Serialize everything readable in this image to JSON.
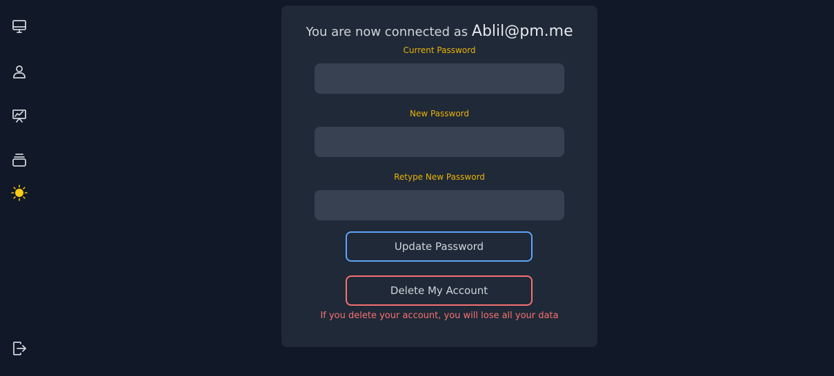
{
  "sidebar": {
    "icons": [
      "monitor-icon",
      "user-icon",
      "presentation-chart-icon",
      "archive-icon",
      "sun-icon",
      "logout-icon"
    ],
    "colors": {
      "icon": "#d1d5db",
      "sun": "#facc15"
    }
  },
  "account": {
    "connected_prefix": "You are now connected as",
    "email": "Ablil@pm.me"
  },
  "form": {
    "current_password_label": "Current Password",
    "new_password_label": "New Password",
    "retype_password_label": "Retype New Password",
    "current_password_value": "",
    "new_password_value": "",
    "retype_password_value": "",
    "update_button": "Update Password",
    "delete_button": "Delete My Account",
    "delete_warning": "If you delete your account, you will lose all your data"
  },
  "colors": {
    "background": "#111827",
    "card": "#1f2937",
    "input": "#374151",
    "label": "#eab308",
    "update_border": "#60a5fa",
    "delete_border": "#f87171",
    "warning": "#f87171"
  }
}
